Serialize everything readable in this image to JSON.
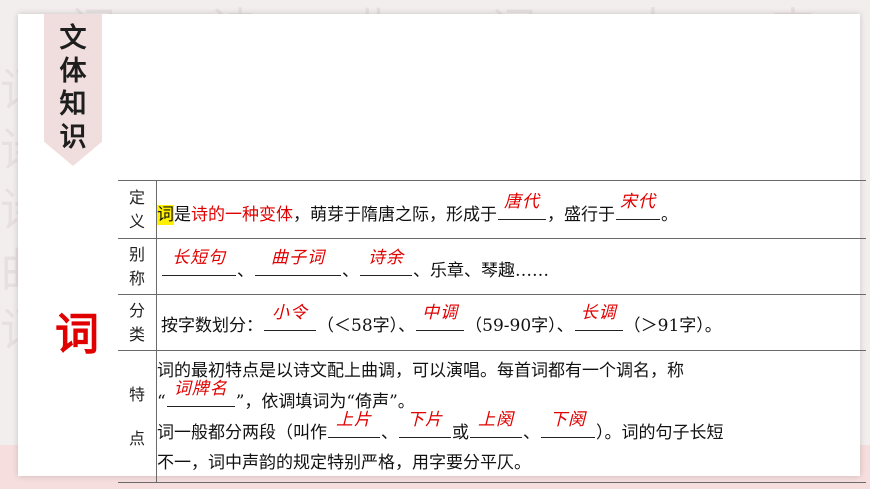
{
  "badge": {
    "chars": [
      "文",
      "体",
      "知",
      "识"
    ]
  },
  "side_char": "词",
  "rows": {
    "dingyi": {
      "label": [
        "定",
        "义"
      ],
      "ci": "词",
      "is": "是",
      "red_phrase": "诗的一种变体",
      "text1": "，萌芽于隋唐之际，形成于",
      "ans1": "唐代",
      "text2": "，盛行于",
      "ans2": "宋代",
      "text3": "。"
    },
    "bieming": {
      "label": [
        "别",
        "称"
      ],
      "ans1": "长短句",
      "sep1": "、",
      "ans2": "曲子词",
      "sep2": "、",
      "ans3": "诗余",
      "text": "、乐章、琴趣……"
    },
    "fenlei": {
      "label": [
        "分",
        "类"
      ],
      "text1": "按字数划分：",
      "ans1": "小令",
      "text2": "（＜58字）、",
      "ans2": "中调",
      "text3": "（59-90字）、",
      "ans3": "长调",
      "text4": "（＞91字）。"
    },
    "tedian": {
      "label": [
        "特",
        "点"
      ],
      "line1": "词的最初特点是以诗文配上曲调，可以演唱。每首词都有一个调名，称",
      "line2a": "“",
      "ans1": "词牌名",
      "line2b": "”，依调填词为“倚声”。",
      "line3a": "词一般都分两段（叫作",
      "ans2": "上片",
      "sep1": "、",
      "ans3": "下片",
      "or": "或",
      "ans4": "上阕",
      "sep2": "、",
      "ans5": "下阕",
      "line3b": "）。词的句子长短",
      "line4": "不一，词中声韵的规定特别严格，用字要分平仄。"
    }
  }
}
